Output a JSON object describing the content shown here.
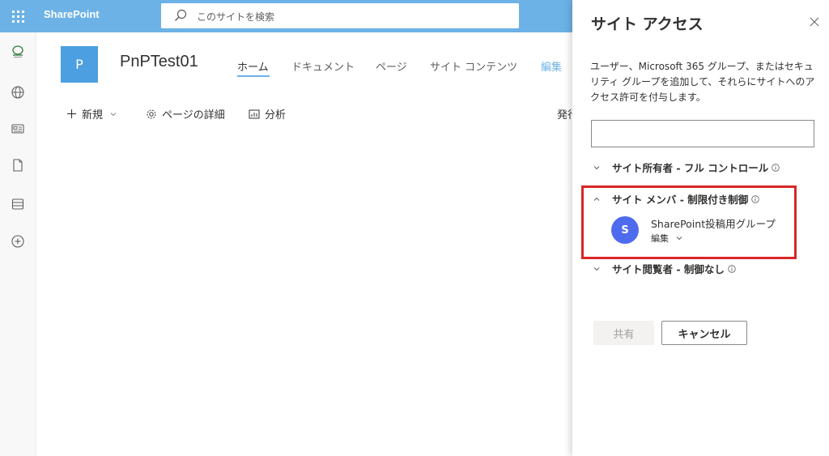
{
  "suitebar": {
    "brand": "SharePoint",
    "search_placeholder": "このサイトを検索",
    "bar_color": "#6cb2e6"
  },
  "appbar": {
    "icons": [
      "sharepoint-home-icon",
      "globe-icon",
      "news-icon",
      "document-icon",
      "list-icon",
      "create-icon"
    ]
  },
  "site": {
    "logo_letter": "P",
    "title": "PnPTest01",
    "nav": [
      "ホーム",
      "ドキュメント",
      "ページ",
      "サイト コンテンツ"
    ],
    "nav_edit": "編集",
    "commands": {
      "new": "新規",
      "page_details": "ページの詳細",
      "analytics": "分析",
      "publish_partial": "発行"
    }
  },
  "panel": {
    "title": "サイト アクセス",
    "description": "ユーザー、Microsoft 365 グループ、またはセキュリティ グループを追加して、それらにサイトへのアクセス許可を付与します。",
    "groups": [
      {
        "label": "サイト所有者 - フル コントロール",
        "expanded": false
      },
      {
        "label": "サイト メンバ - 制限付き制御",
        "expanded": true
      },
      {
        "label": "サイト閲覧者 - 制御なし",
        "expanded": false
      }
    ],
    "member": {
      "initial": "S",
      "name": "SharePoint投稿用グループ",
      "role": "編集",
      "avatar_color": "#4f6bed"
    },
    "share_label": "共有",
    "cancel_label": "キャンセル",
    "highlight_color": "#d92626"
  }
}
